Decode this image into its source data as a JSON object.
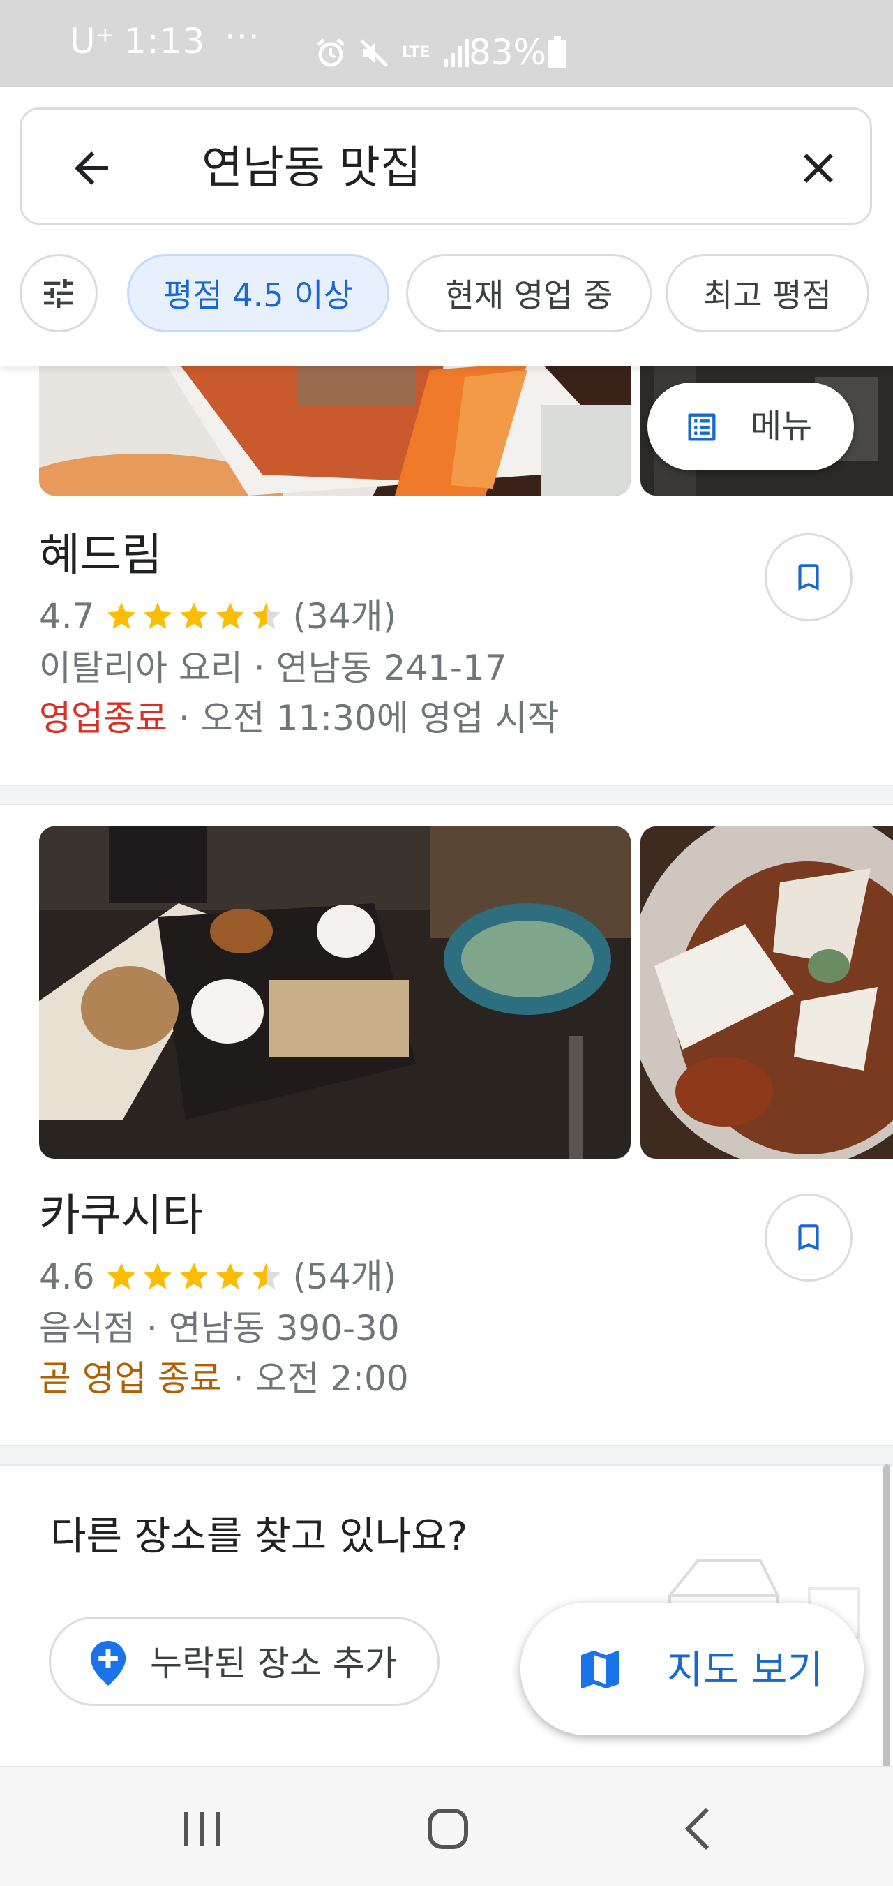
{
  "status_bar": {
    "carrier": "U⁺",
    "time": "1:13",
    "more_dots": "···",
    "network": "LTE",
    "battery": "83%"
  },
  "search": {
    "query": "연남동 맛집"
  },
  "filter_chips": [
    {
      "label": "평점 4.5 이상",
      "active": true
    },
    {
      "label": "현재 영업 중",
      "active": false
    },
    {
      "label": "최고 평점",
      "active": false
    }
  ],
  "menu_button": {
    "label": "메뉴"
  },
  "results": [
    {
      "name": "혜드림",
      "rating": "4.7",
      "stars": 4.5,
      "review_count": "(34개)",
      "category_address": "이탈리아 요리 · 연남동 241-17",
      "status": "영업종료",
      "status_detail": " · 오전 11:30에 영업 시작"
    },
    {
      "name": "카쿠시타",
      "rating": "4.6",
      "stars": 4.5,
      "review_count": "(54개)",
      "category_address": "음식점 · 연남동 390-30",
      "status": "곧 영업 종료",
      "status_detail": " · 오전 2:00"
    }
  ],
  "more": {
    "title": "다른 장소를 찾고 있나요?",
    "add_place_label": "누락된 장소 추가"
  },
  "map_fab": {
    "label": "지도 보기"
  },
  "colors": {
    "accent_blue": "#1967d2",
    "star_yellow": "#fbbc04",
    "closed_red": "#d93025",
    "soon_orange": "#b06000",
    "chip_active_bg": "#e8f0fe"
  }
}
